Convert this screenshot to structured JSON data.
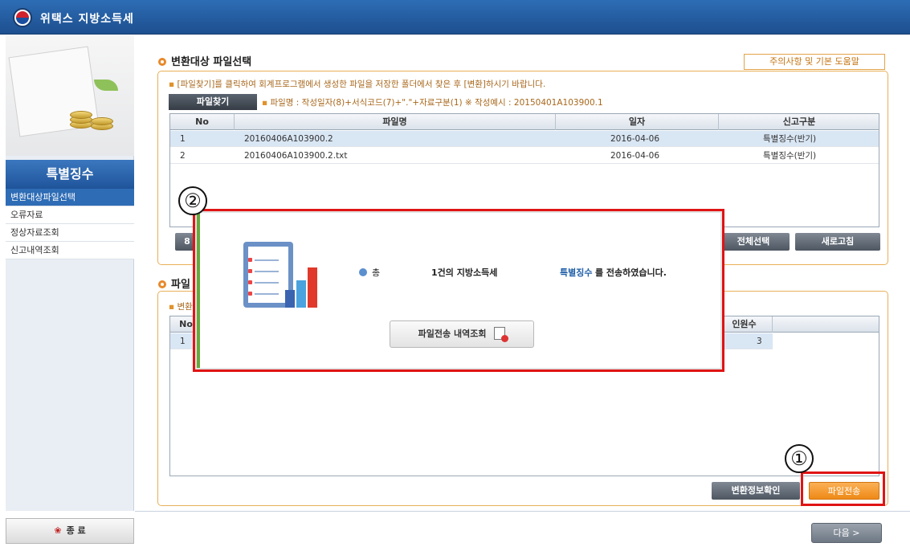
{
  "app": {
    "title": "위택스 지방소득세"
  },
  "sidebar": {
    "section_title": "특별징수",
    "items": [
      {
        "label": "변환대상파일선택",
        "active": true
      },
      {
        "label": "오류자료",
        "active": false
      },
      {
        "label": "정상자료조회",
        "active": false
      },
      {
        "label": "신고내역조회",
        "active": false
      }
    ],
    "exit_label": "종 료"
  },
  "section1": {
    "title": "변환대상 파일선택",
    "help_button": "주의사항 및 기본 도움말",
    "notice": "[파일찾기]를 클릭하여 회계프로그램에서 생성한 파일을 저장한 폴더에서 찾은 후 [변환]하시기 바랍니다.",
    "find_button": "파일찾기",
    "file_hint": "파일명 : 작성일자(8)+서식코드(7)+\".\"+자료구분(1)  ※ 작성예시 : 20150401A103900.1",
    "columns": [
      "No",
      "파일명",
      "일자",
      "신고구분"
    ],
    "rows": [
      {
        "no": "1",
        "file": "20160406A103900.2",
        "date": "2016-04-06",
        "type": "특별징수(반기)"
      },
      {
        "no": "2",
        "file": "20160406A103900.2.txt",
        "date": "2016-04-06",
        "type": "특별징수(반기)"
      }
    ],
    "partial_button_left": "8",
    "select_all_button": "전체선택",
    "refresh_button": "새로고침"
  },
  "section2": {
    "title_partial": "파일",
    "notice_partial": "변환",
    "col_no": "No",
    "col_people_partial": "인원수",
    "row_no": "1",
    "row_people": "3",
    "verify_button": "변환정보확인",
    "send_button": "파일전송"
  },
  "popup": {
    "prefix": "총",
    "count_text": "1건의 지방소득세",
    "highlight": "특별징수",
    "suffix": "를 전송하였습니다.",
    "history_button": "파일전송 내역조회"
  },
  "annotations": {
    "one": "①",
    "two": "②"
  },
  "footer": {
    "next_button": "다음 >"
  },
  "colors": {
    "accent": "#2e6cb5",
    "orange": "#ee8a17",
    "highlight_box": "#e01414"
  }
}
